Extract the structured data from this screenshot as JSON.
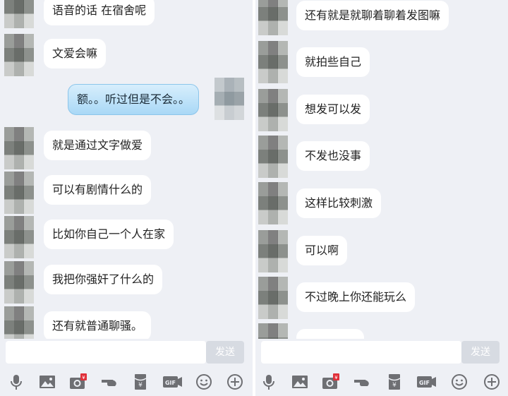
{
  "left_panel": {
    "messages": [
      {
        "side": "in",
        "text": "语音的话 在宿舍呢"
      },
      {
        "side": "in",
        "text": "文爱会嘛"
      },
      {
        "side": "out",
        "text": "额。。听过但是不会。。"
      },
      {
        "side": "in",
        "text": "就是通过文字做爱"
      },
      {
        "side": "in",
        "text": "可以有剧情什么的"
      },
      {
        "side": "in",
        "text": "比如你自己一个人在家"
      },
      {
        "side": "in",
        "text": "我把你强奸了什么的"
      },
      {
        "side": "in",
        "text": "还有就普通聊骚。"
      }
    ],
    "send_label": "发送"
  },
  "right_panel": {
    "messages": [
      {
        "side": "in",
        "text": "还有就是就聊着聊着发图嘛"
      },
      {
        "side": "in",
        "text": "就拍些自己"
      },
      {
        "side": "in",
        "text": "想发可以发"
      },
      {
        "side": "in",
        "text": "不发也没事"
      },
      {
        "side": "in",
        "text": "这样比较刺激"
      },
      {
        "side": "in",
        "text": "可以啊"
      },
      {
        "side": "in",
        "text": "不过晚上你还能玩么"
      }
    ],
    "send_label": "发送"
  },
  "toolbar": {
    "icons": [
      "microphone-icon",
      "image-icon",
      "camera-redpacket-icon",
      "poke-icon",
      "red-envelope-icon",
      "gif-icon",
      "emoji-icon",
      "plus-icon"
    ],
    "gif_label": "GIF",
    "redpacket_badge": "¥",
    "envelope_mark": "¥"
  },
  "colors": {
    "background": "#eef0f5",
    "incoming_bubble": "#ffffff",
    "outgoing_bubble": "#a9d8f6",
    "send_button": "#d7dbe2",
    "icon_gray": "#6e6f73",
    "badge_red": "#e0303a"
  }
}
